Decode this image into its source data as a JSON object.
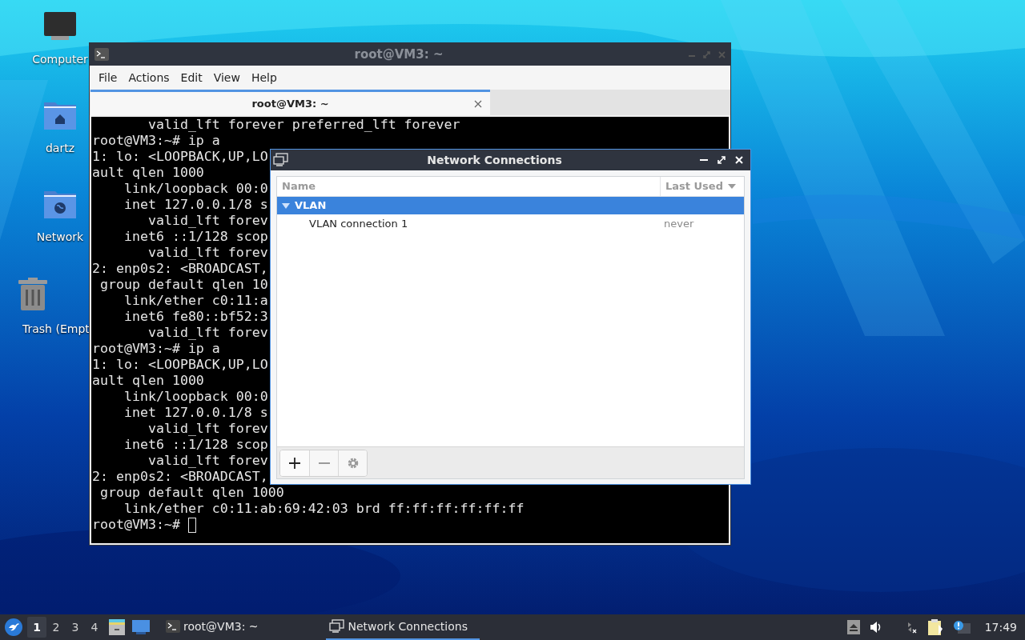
{
  "desktop_icons": [
    {
      "label": "Computer",
      "kind": "computer"
    },
    {
      "label": "dartz",
      "kind": "home"
    },
    {
      "label": "Network",
      "kind": "network"
    },
    {
      "label": "Trash (Empt",
      "kind": "trash"
    }
  ],
  "terminal": {
    "title": "root@VM3: ~",
    "menu": [
      "File",
      "Actions",
      "Edit",
      "View",
      "Help"
    ],
    "tabs": [
      {
        "label": "root@VM3: ~",
        "selected": true
      }
    ],
    "lines": [
      "       valid_lft forever preferred_lft forever",
      "root@VM3:~# ip a",
      "1: lo: <LOOPBACK,UP,LO",
      "ault qlen 1000",
      "    link/loopback 00:0",
      "    inet 127.0.0.1/8 s",
      "       valid_lft forev",
      "    inet6 ::1/128 scop",
      "       valid_lft forev",
      "2: enp0s2: <BROADCAST,",
      " group default qlen 10",
      "    link/ether c0:11:a",
      "    inet6 fe80::bf52:3",
      "       valid_lft forev",
      "root@VM3:~# ip a",
      "1: lo: <LOOPBACK,UP,LO",
      "ault qlen 1000",
      "    link/loopback 00:0",
      "    inet 127.0.0.1/8 s",
      "       valid_lft forev",
      "    inet6 ::1/128 scop",
      "       valid_lft forev",
      "2: enp0s2: <BROADCAST,",
      " group default qlen 1000",
      "    link/ether c0:11:ab:69:42:03 brd ff:ff:ff:ff:ff:ff",
      "root@VM3:~# "
    ]
  },
  "dialog": {
    "title": "Network Connections",
    "columns": [
      "Name",
      "Last Used"
    ],
    "groups": [
      {
        "label": "VLAN",
        "expanded": true,
        "selected": true,
        "children": [
          {
            "name": "VLAN connection 1",
            "last_used": "never",
            "selected": false
          }
        ]
      }
    ],
    "toolbar": [
      {
        "kind": "add",
        "disabled": false
      },
      {
        "kind": "remove",
        "disabled": true
      },
      {
        "kind": "settings",
        "disabled": true
      }
    ]
  },
  "taskbar": {
    "workspaces": [
      {
        "label": "1",
        "selected": true
      },
      {
        "label": "2",
        "selected": false
      },
      {
        "label": "3",
        "selected": false
      },
      {
        "label": "4",
        "selected": false
      }
    ],
    "tasks": [
      {
        "label": "root@VM3: ~",
        "kind": "terminal",
        "selected": false
      },
      {
        "label": "Network Connections",
        "kind": "network",
        "selected": true
      }
    ],
    "clock": "17:49"
  }
}
